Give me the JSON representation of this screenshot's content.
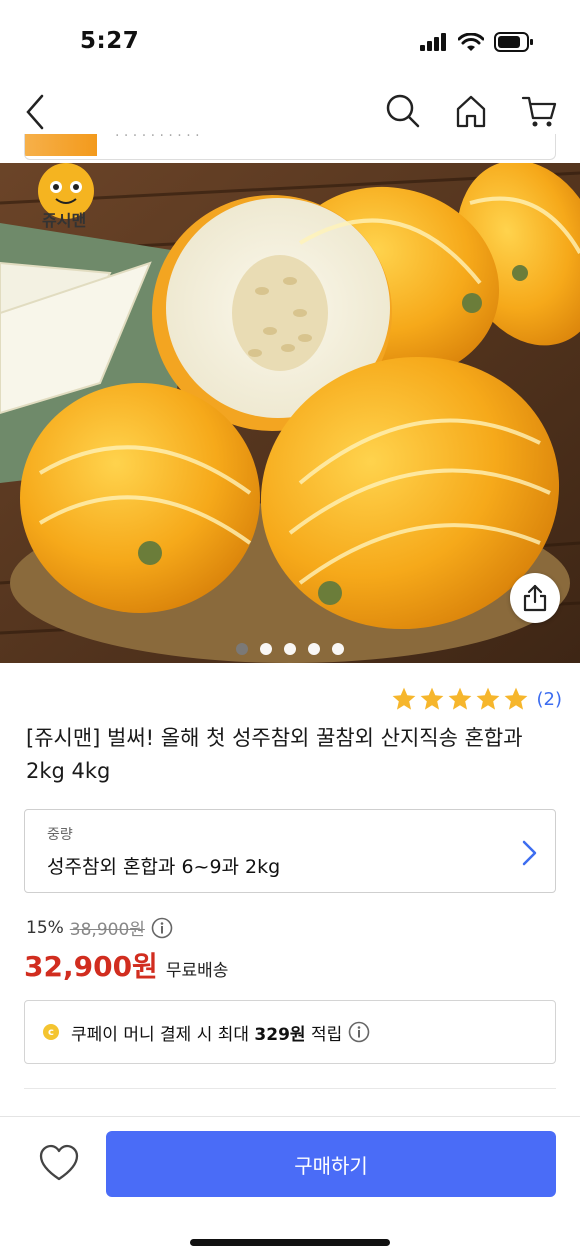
{
  "status": {
    "time": "5:27"
  },
  "nav": {
    "icons": [
      "back-icon",
      "search-icon",
      "home-icon",
      "cart-icon"
    ]
  },
  "sticky": {
    "text": "· · · · · · · · · ·"
  },
  "hero": {
    "brand_badge": "쥬시맨",
    "carousel": {
      "total": 5,
      "active_index": 0
    }
  },
  "rating": {
    "stars": 5,
    "count": "(2)"
  },
  "product": {
    "title": "[쥬시맨] 벌써! 올해 첫 성주참외 꿀참외 산지직송 혼합과 2kg 4kg"
  },
  "option": {
    "label": "중량",
    "value": "성주참외 혼합과 6~9과 2kg"
  },
  "price": {
    "discount": "15%",
    "original": "38,900원",
    "sale": "32,900원",
    "shipping": "무료배송"
  },
  "coupon": {
    "prefix": "쿠페이 머니 결제 시 최대 ",
    "amount": "329원",
    "suffix": " 적립"
  },
  "bottom": {
    "buy_label": "구매하기"
  },
  "colors": {
    "accent": "#4a6cf7",
    "sale": "#d12d1f",
    "star": "#f6b62c",
    "link": "#3d6df0"
  }
}
